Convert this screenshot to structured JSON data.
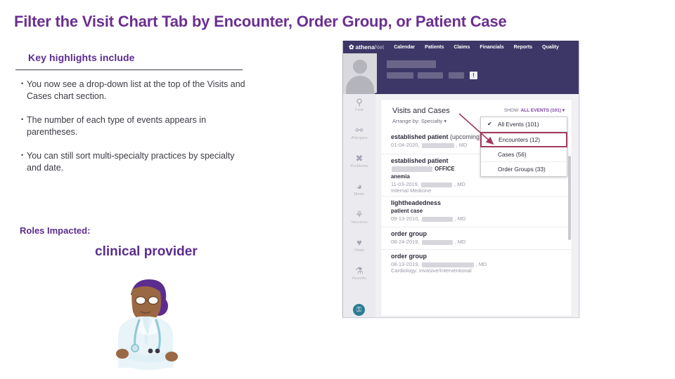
{
  "slide": {
    "title": "Filter the Visit Chart  Tab by Encounter, Order Group, or Patient Case",
    "title_color": "#6b2f91"
  },
  "highlights": {
    "heading": "Key highlights include",
    "bullets": [
      "You now see a drop-down list at the top of the Visits and Cases chart section.",
      "The number of each type of events appears in parentheses.",
      "You can still sort multi-specialty practices by specialty and date."
    ]
  },
  "roles": {
    "label": "Roles Impacted:",
    "value": "clinical provider"
  },
  "screenshot": {
    "topnav": {
      "logo_mark": "athena",
      "logo_suffix": "Net",
      "items": [
        "Calendar",
        "Patients",
        "Claims",
        "Financials",
        "Reports",
        "Quality"
      ]
    },
    "patient_header": {
      "name_redacted": true,
      "badge": "!"
    },
    "sidebar": {
      "items": [
        {
          "label": "Find",
          "icon": "magnifier-icon",
          "glyph": "⌕"
        },
        {
          "label": "Allergies",
          "icon": "allergy-icon",
          "glyph": "⚲"
        },
        {
          "label": "Problems",
          "icon": "bandage-icon",
          "glyph": "✘"
        },
        {
          "label": "Meds",
          "icon": "pills-icon",
          "glyph": "◕"
        },
        {
          "label": "Vaccines",
          "icon": "syringe-icon",
          "glyph": "⚗"
        },
        {
          "label": "Vitals",
          "icon": "heart-icon",
          "glyph": "♥"
        },
        {
          "label": "Results",
          "icon": "flask-icon",
          "glyph": "⚗"
        }
      ],
      "bottom_icon": "lock-icon",
      "bottom_glyph": "⚿"
    },
    "panel": {
      "title": "Visits and Cases",
      "arrange_by": "Arrange by: Specialty ▾",
      "show_label": "SHOW:",
      "show_value": "ALL EVENTS (101)",
      "show_caret": "▾"
    },
    "dropdown": {
      "options": [
        {
          "label": "All Events (101)",
          "checked": true,
          "highlighted": false
        },
        {
          "label": "Encounters (12)",
          "checked": false,
          "highlighted": true
        },
        {
          "label": "Cases (56)",
          "checked": false,
          "highlighted": false
        },
        {
          "label": "Order Groups (33)",
          "checked": false,
          "highlighted": false
        }
      ],
      "check_glyph": "✔",
      "highlight_color": "#a03b5c"
    },
    "events": [
      {
        "title": "established patient",
        "title_suffix": " (upcoming)",
        "line1": "01-04-2020,",
        "line1_tail": ", MD",
        "line2": "",
        "bold_line": "",
        "office": ""
      },
      {
        "title": "established patient",
        "title_suffix": "",
        "office": "OFFICE",
        "bold_line": "anemia",
        "line1": "11-03-2019,",
        "line1_tail": ", MD",
        "line2": "Internal Medicine"
      },
      {
        "title": "lightheadedness",
        "title_suffix": "",
        "bold_line": "patient case",
        "line1": "09-13-2010,",
        "line1_tail": ", MD",
        "line2": "",
        "office": ""
      },
      {
        "title": "order group",
        "title_suffix": "",
        "bold_line": "",
        "line1": "08-24-2019,",
        "line1_tail": ", MD",
        "line2": "",
        "office": ""
      },
      {
        "title": "order group",
        "title_suffix": "",
        "bold_line": "",
        "line1": "08-13-2019,",
        "line1_tail": ", MD",
        "line2": "Cardiology: Invasive/Interventional",
        "office": ""
      }
    ],
    "annotation": {
      "arrow_color": "#a03b5c"
    }
  }
}
